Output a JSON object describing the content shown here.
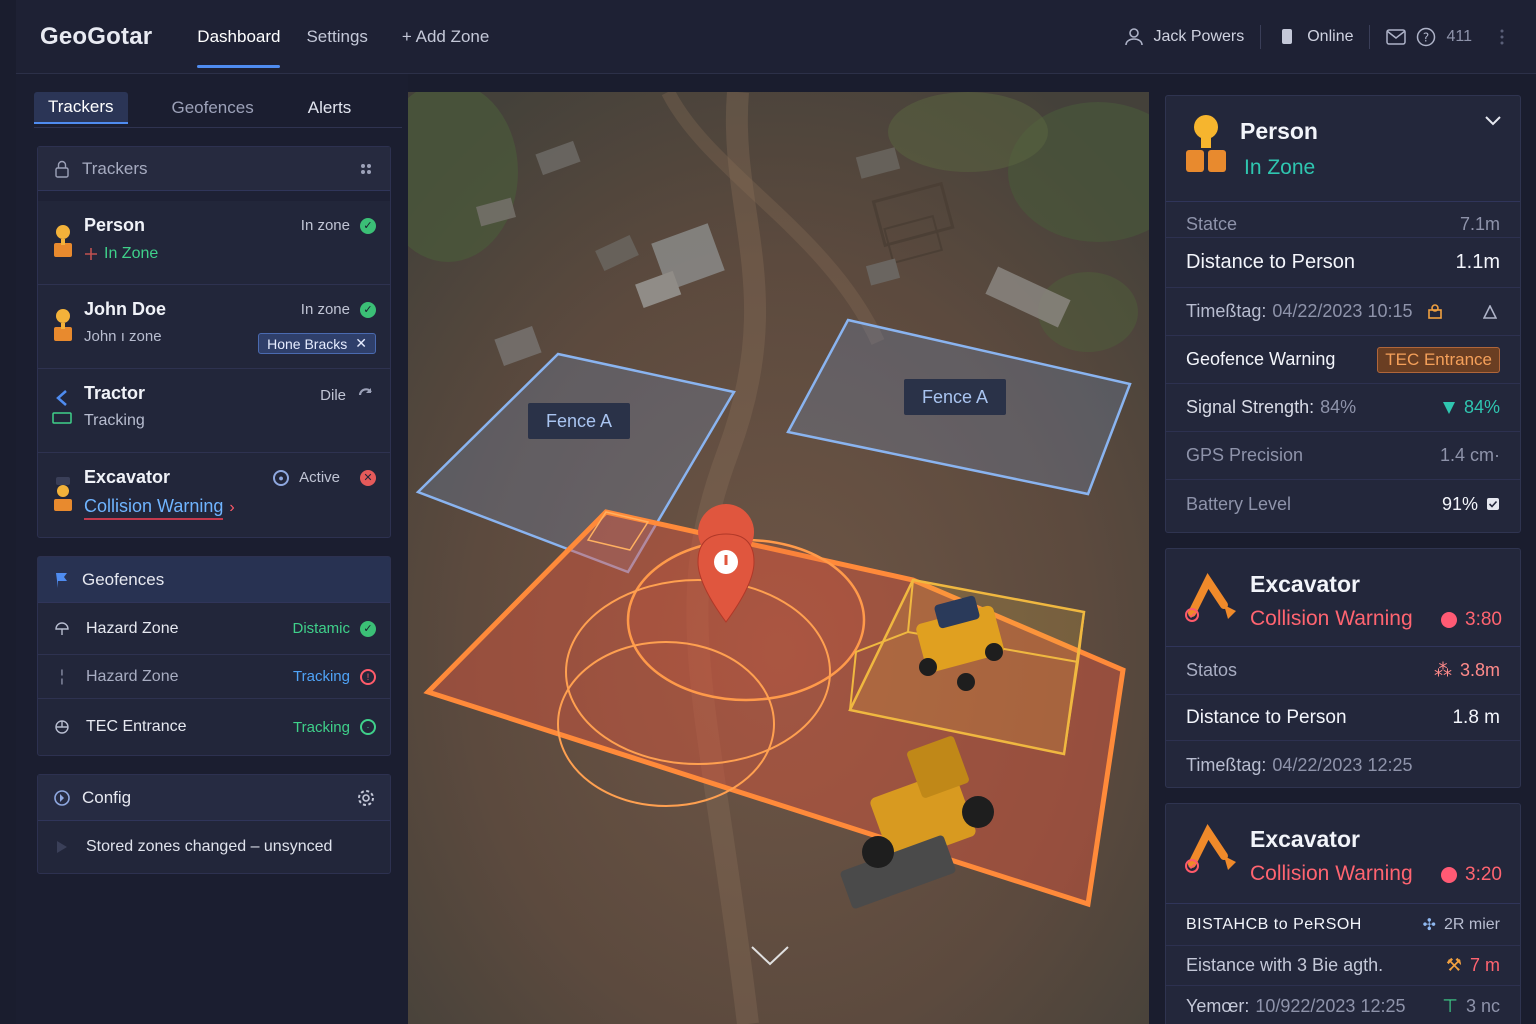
{
  "app": {
    "brand": "GeoGotar",
    "nav": [
      "Dashboard",
      "Settings",
      "+ Add Zone"
    ],
    "user": "Jack Powers",
    "status": "Online",
    "count": "411"
  },
  "left": {
    "tabs": [
      "Trackers",
      "Geofences",
      "Alerts"
    ],
    "trackers_header": "Trackers",
    "trackers": [
      {
        "name": "Person",
        "sub": "In Zone",
        "status": "In zone"
      },
      {
        "name": "John Doe",
        "sub": "John ı zone",
        "status": "In zone",
        "tag": "Hone Bracks"
      },
      {
        "name": "Tractor",
        "sub": "Tracking",
        "status": "Dile"
      },
      {
        "name": "Excavator",
        "sub": "Collision Warning",
        "status": "Active"
      }
    ],
    "geofences_header": "Geofences",
    "geofences": [
      {
        "name": "Hazard Zone",
        "status": "Distamic"
      },
      {
        "name": "Hazard Zone",
        "status": "Tracking"
      },
      {
        "name": "TEC Entrance",
        "status": "Tracking"
      }
    ],
    "config_header": "Config",
    "config_msg": "Stored zones changed – unsynced"
  },
  "map": {
    "fence_labels": [
      "Fence A",
      "Fence A"
    ],
    "colors": {
      "fence_blue": "#8ab4f0",
      "hazard_orange": "#ff8a3a",
      "pin_red": "#e0563e"
    }
  },
  "right": {
    "person": {
      "title": "Person",
      "sub": "In Zone",
      "rows": [
        {
          "k": "Statce",
          "v": "7.1m"
        },
        {
          "k": "Distance to Person",
          "v": "1.1m"
        },
        {
          "k": "Timeßtag:",
          "k2": "04/22/2023 10:15"
        },
        {
          "k": "Geofence Warning",
          "v": "TEC Entrance"
        },
        {
          "k": "Signal Strength:",
          "k2": "84%",
          "v": "84%"
        },
        {
          "k": "GPS Precision",
          "v": "1.4 cm·"
        },
        {
          "k": "Battery Level",
          "v": "91%"
        }
      ]
    },
    "excavator1": {
      "title": "Excavator",
      "sub": "Collision Warning",
      "time": "3:80",
      "rows": [
        {
          "k": "Statos",
          "v": "3.8m"
        },
        {
          "k": "Distance to Person",
          "v": "1.8 m"
        },
        {
          "k": "Timeßtag:",
          "k2": "04/22/2023 12:25"
        }
      ]
    },
    "excavator2": {
      "title": "Excavator",
      "sub": "Collision Warning",
      "time": "3:20",
      "rows": [
        {
          "k": "BISTAHCB to PeRSOH",
          "v": "2R mier"
        },
        {
          "k": "Eistance with 3 Bie agth.",
          "v": "7 m"
        },
        {
          "k": "Yemœr:",
          "k2": "10/922/2023 12:25",
          "v": "3 nc"
        }
      ]
    }
  }
}
